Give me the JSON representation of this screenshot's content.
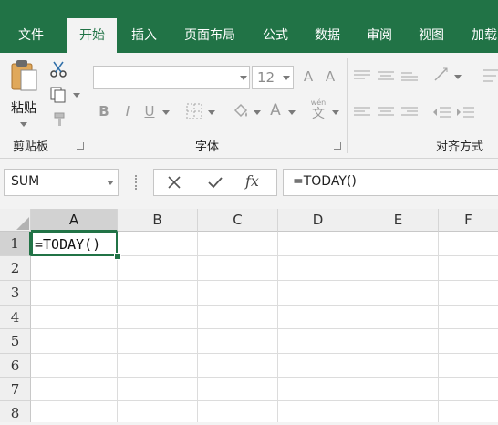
{
  "colors": {
    "accent": "#217346",
    "ribbon_bg": "#f3f3f3",
    "grid_line": "#dcdcdc"
  },
  "tabs": [
    {
      "label": "文件",
      "active": false
    },
    {
      "label": "开始",
      "active": true
    },
    {
      "label": "插入",
      "active": false
    },
    {
      "label": "页面布局",
      "active": false
    },
    {
      "label": "公式",
      "active": false
    },
    {
      "label": "数据",
      "active": false
    },
    {
      "label": "审阅",
      "active": false
    },
    {
      "label": "视图",
      "active": false
    },
    {
      "label": "加载",
      "active": false
    }
  ],
  "ribbon": {
    "clipboard": {
      "paste_label": "粘贴",
      "group_label": "剪贴板"
    },
    "font": {
      "font_name": "",
      "font_size": "12",
      "grow_label": "A",
      "shrink_label": "A",
      "bold": "B",
      "italic": "I",
      "underline": "U",
      "font_color_label": "A",
      "phonetic_label": "wén",
      "phonetic_char": "文",
      "group_label": "字体"
    },
    "alignment": {
      "group_label": "对齐方式"
    }
  },
  "formula_bar": {
    "name_box": "SUM",
    "fx_label": "fx",
    "formula": "=TODAY()"
  },
  "sheet": {
    "columns": [
      "A",
      "B",
      "C",
      "D",
      "E",
      "F"
    ],
    "rows": [
      "1",
      "2",
      "3",
      "4",
      "5",
      "6",
      "7",
      "8"
    ],
    "active_cell": "A1",
    "cells": {
      "A1": "=TODAY()"
    }
  }
}
